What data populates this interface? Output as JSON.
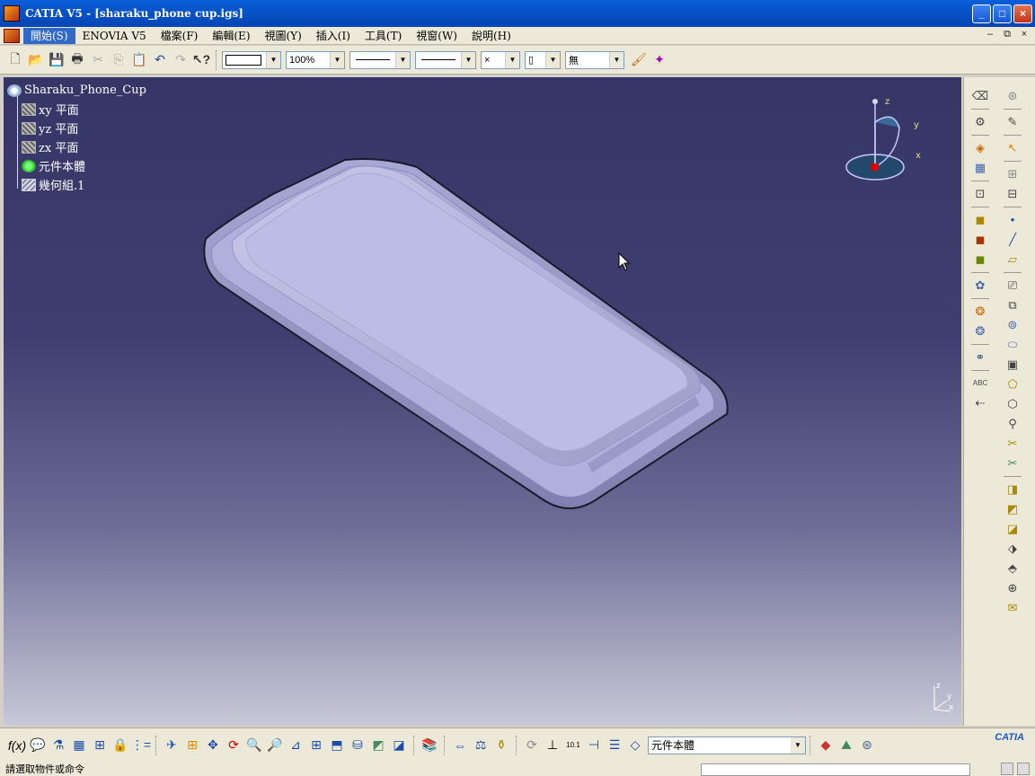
{
  "window": {
    "title": "CATIA V5 - [sharaku_phone cup.igs]",
    "controls": [
      "_",
      "□",
      "×"
    ]
  },
  "menu": {
    "items": [
      "開始(S)",
      "ENOVIA V5",
      "檔案(F)",
      "編輯(E)",
      "視圖(Y)",
      "插入(I)",
      "工具(T)",
      "視窗(W)",
      "說明(H)"
    ],
    "mdi_controls": [
      "–",
      "⧉",
      "×"
    ]
  },
  "toolbar": {
    "zoom_value": "100%",
    "layer_value": "無",
    "linetype_value": "×"
  },
  "tree": {
    "root": "Sharaku_Phone_Cup",
    "children": [
      "xy 平面",
      "yz 平面",
      "zx 平面",
      "元件本體",
      "幾何組.1"
    ]
  },
  "compass": {
    "axis_z": "z",
    "axis_y": "y",
    "axis_x": "x"
  },
  "bottom_toolbar": {
    "current_body": "元件本體",
    "brand": "CATIA"
  },
  "status": {
    "message": "請選取物件或命令"
  },
  "colors": {
    "viewport_top": "#363666",
    "viewport_bottom": "#c8c8d8",
    "part_fill": "#b4b4e0",
    "titlebar": "#0753c9"
  }
}
